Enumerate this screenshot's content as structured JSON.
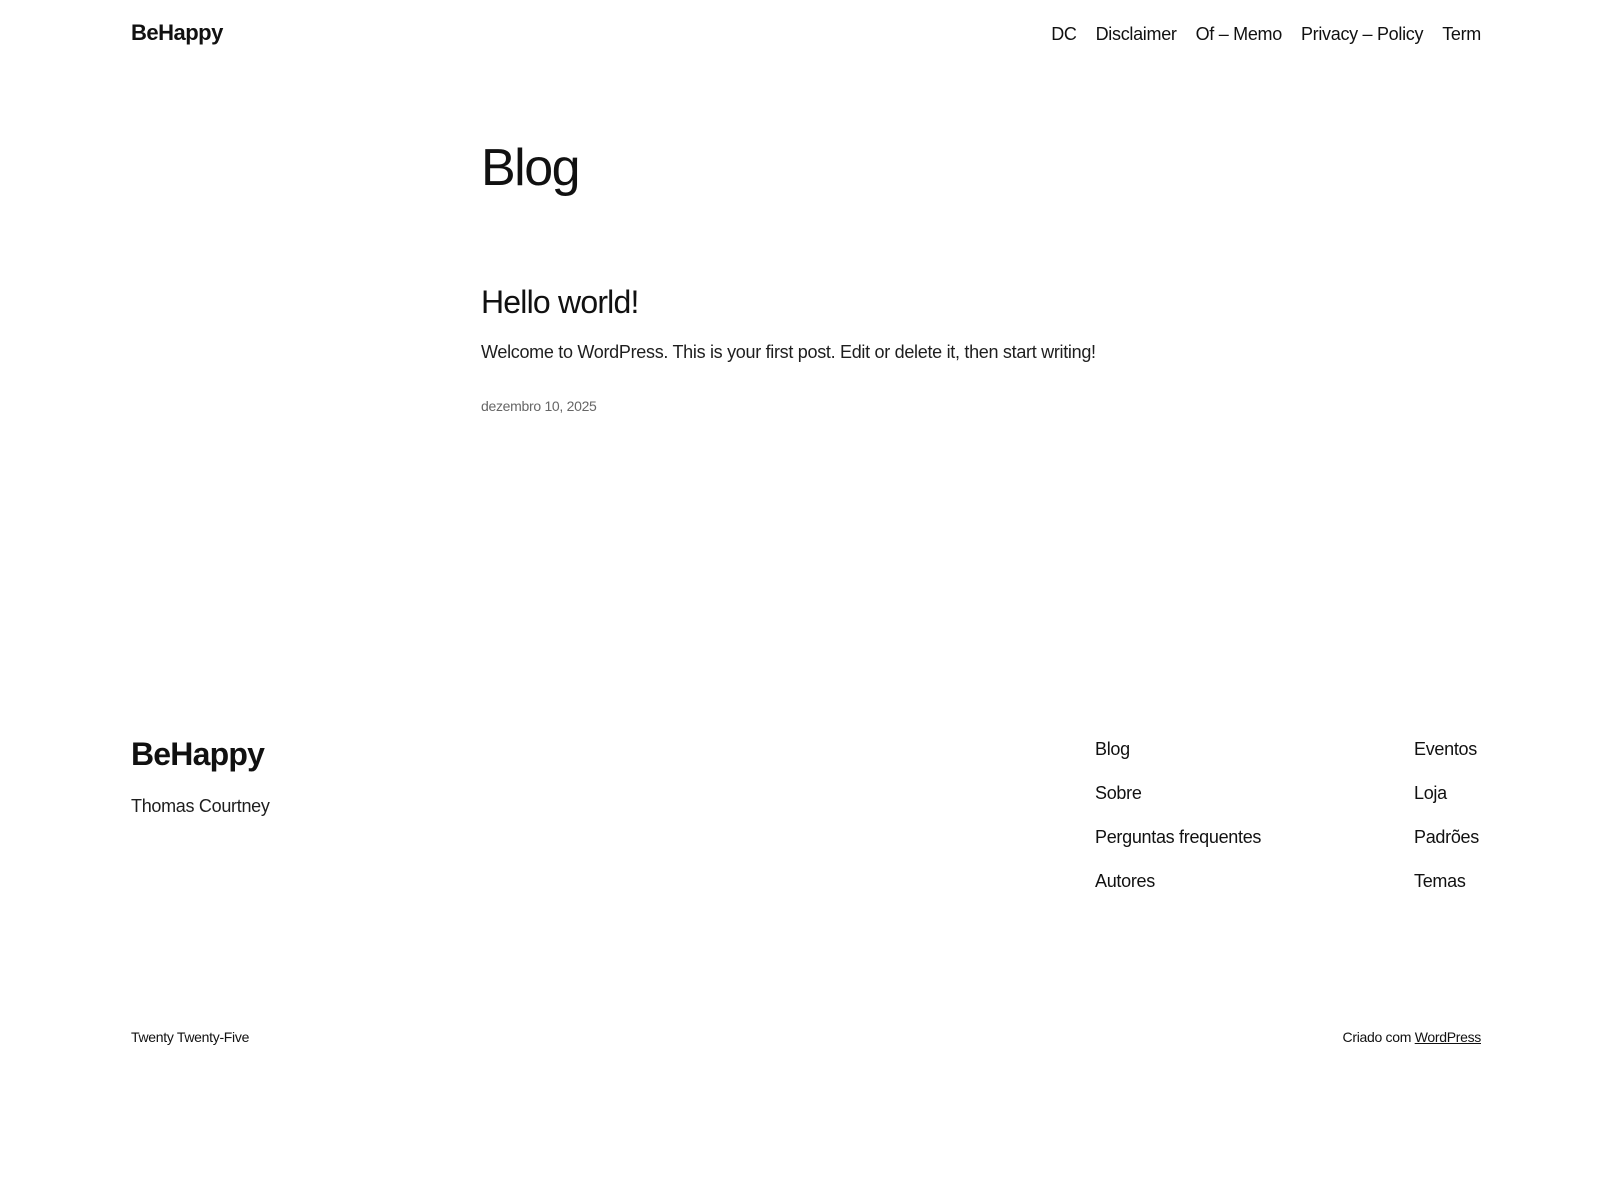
{
  "header": {
    "site_title": "BeHappy",
    "nav": [
      {
        "label": "DC"
      },
      {
        "label": "Disclaimer"
      },
      {
        "label": "Of – Memo"
      },
      {
        "label": "Privacy – Policy"
      },
      {
        "label": "Term"
      }
    ]
  },
  "main": {
    "page_title": "Blog",
    "post": {
      "title": "Hello world!",
      "excerpt": "Welcome to WordPress. This is your first post. Edit or delete it, then start writing!",
      "date": "dezembro 10, 2025"
    }
  },
  "footer": {
    "site_title": "BeHappy",
    "tagline": "Thomas Courtney",
    "col1": [
      {
        "label": "Blog"
      },
      {
        "label": "Sobre"
      },
      {
        "label": "Perguntas frequentes"
      },
      {
        "label": "Autores"
      }
    ],
    "col2": [
      {
        "label": "Eventos"
      },
      {
        "label": "Loja"
      },
      {
        "label": "Padrões"
      },
      {
        "label": "Temas"
      }
    ],
    "theme_name": "Twenty Twenty-Five",
    "credit_prefix": "Criado com ",
    "credit_link": "WordPress"
  }
}
